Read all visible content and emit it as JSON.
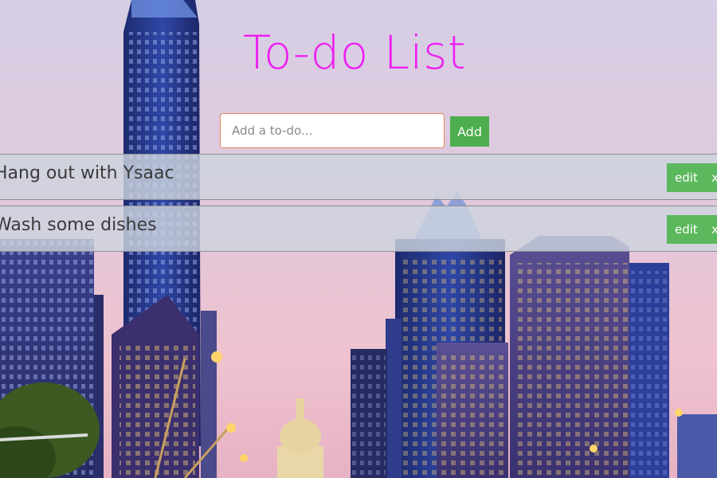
{
  "app": {
    "title": "To-do List"
  },
  "form": {
    "input_placeholder": "Add a to-do...",
    "input_value": "",
    "add_label": "Add"
  },
  "todos": [
    {
      "text": "Hang out with Ysaac",
      "edit_label": "edit",
      "delete_label": "x"
    },
    {
      "text": "Wash some dishes",
      "edit_label": "edit",
      "delete_label": "x"
    }
  ],
  "colors": {
    "title": "#ee1cf2",
    "button_green": "#5cb85c",
    "add_green": "#4cae4c",
    "input_border": "#e8855a"
  }
}
